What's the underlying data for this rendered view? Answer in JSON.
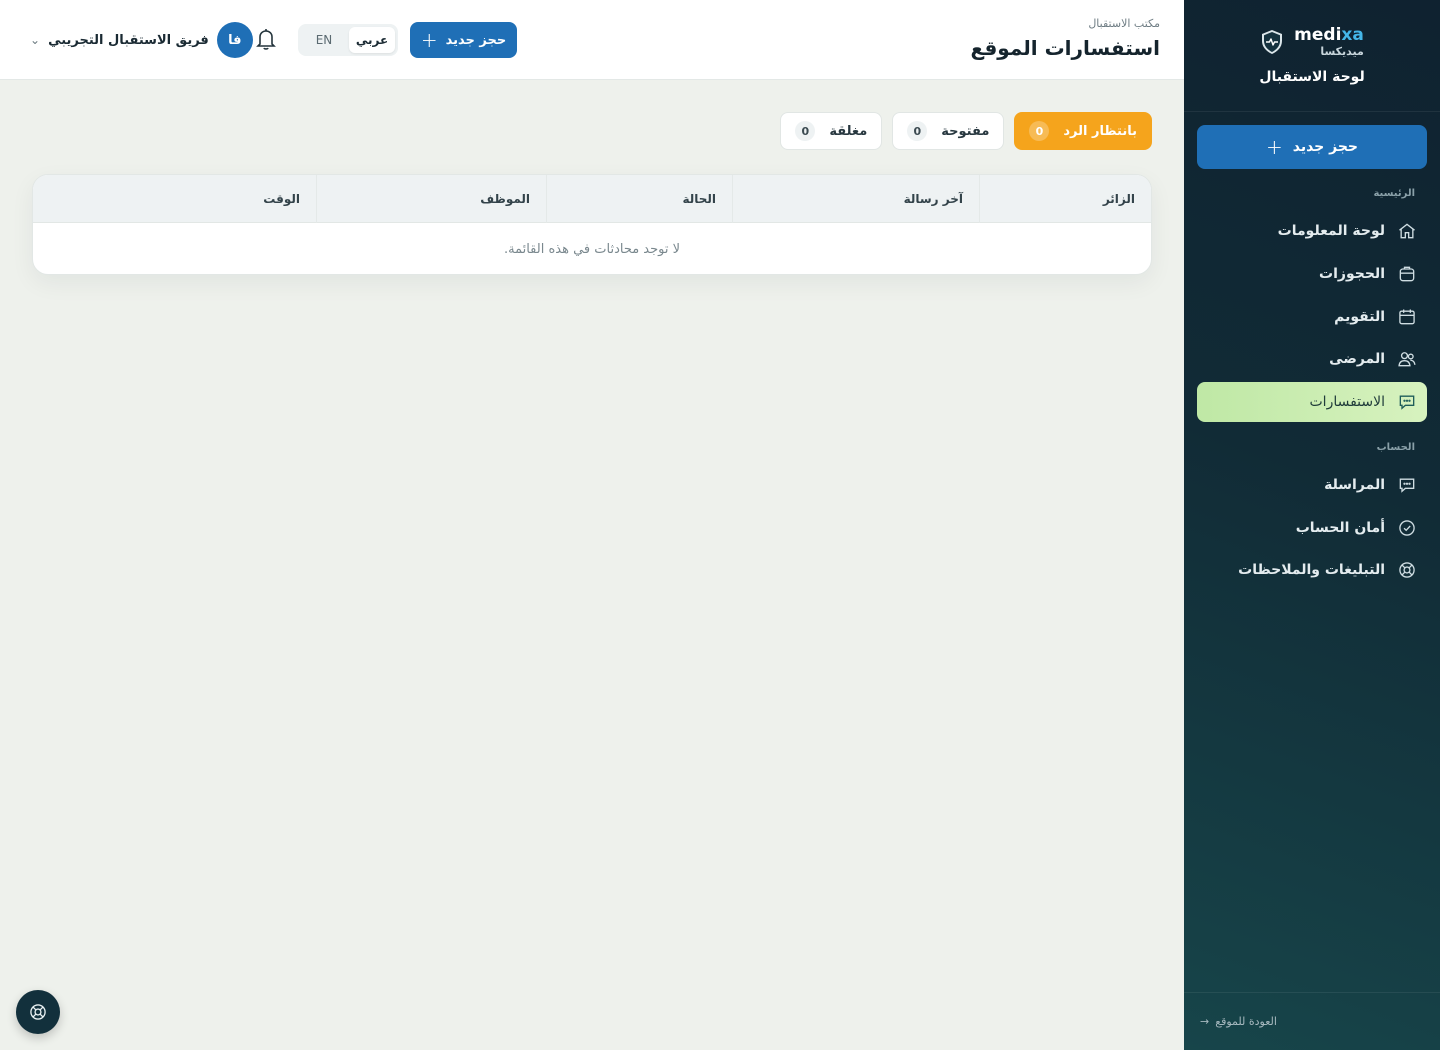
{
  "brand": {
    "latin_a": "medi",
    "latin_b": "xa",
    "arabic": "ميديكسا",
    "subtitle": "لوحة الاستقبال"
  },
  "sidebar": {
    "new_booking": "حجز جديد",
    "section_main": "الرئيسية",
    "section_account": "الحساب",
    "items": [
      {
        "label": "لوحة المعلومات",
        "icon": "home-icon"
      },
      {
        "label": "الحجوزات",
        "icon": "briefcase-icon"
      },
      {
        "label": "التقويم",
        "icon": "calendar-icon"
      },
      {
        "label": "المرضى",
        "icon": "users-icon"
      },
      {
        "label": "الاستفسارات",
        "icon": "chat-icon"
      },
      {
        "label": "المراسلة",
        "icon": "chat-icon"
      },
      {
        "label": "أمان الحساب",
        "icon": "check-circle-icon"
      },
      {
        "label": "التبليغات والملاحظات",
        "icon": "lifebuoy-icon"
      }
    ],
    "back_to_site": "العودة للموقع"
  },
  "header": {
    "breadcrumb": "مكتب الاستقبال",
    "title": "استفسارات الموقع",
    "new_booking": "حجز جديد",
    "lang_ar": "عربي",
    "lang_en": "EN",
    "user_initials": "فا",
    "user_name": "فريق الاستقبال التجريبي"
  },
  "tabs": [
    {
      "label": "بانتظار الرد",
      "count": "0"
    },
    {
      "label": "مفتوحة",
      "count": "0"
    },
    {
      "label": "مغلقة",
      "count": "0"
    }
  ],
  "table": {
    "columns": [
      "الزائر",
      "آخر رسالة",
      "الحالة",
      "الموظف",
      "الوقت"
    ],
    "empty_message": "لا توجد محادثات في هذه القائمة."
  },
  "colors": {
    "accent": "#1f6fb6",
    "active_tab": "#f5a41c",
    "sidebar_active": "#c9eeb1"
  }
}
